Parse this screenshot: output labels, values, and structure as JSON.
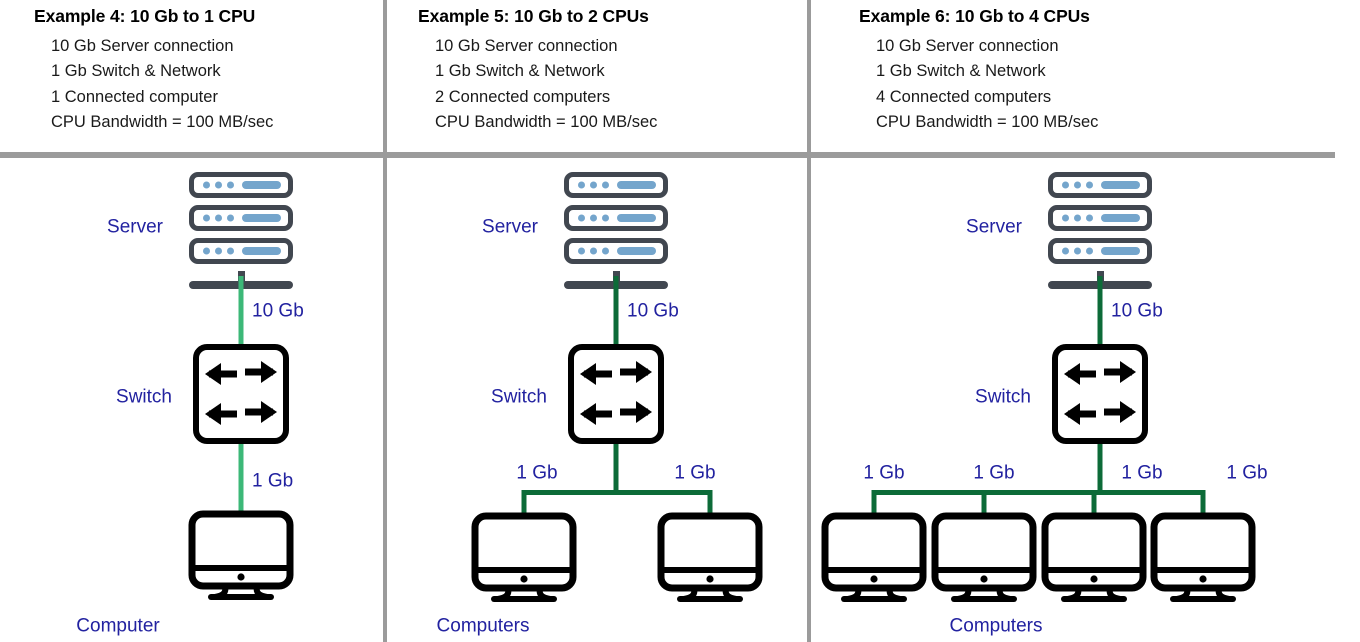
{
  "theme": {
    "label_color": "#2222a0",
    "link_color_dark": "#0c6b38",
    "link_color_light": "#3cb878",
    "server_color": "#414750",
    "server_accent": "#74a5cc",
    "divider_color": "#9b9b9b",
    "icon_color": "#000000",
    "background": "#ffffff"
  },
  "panels": [
    {
      "id": "example-4",
      "title": "Example 4: 10 Gb to 1 CPU",
      "specs": [
        "10 Gb Server connection",
        "1 Gb Switch & Network",
        "1 Connected computer",
        "CPU Bandwidth = 100 MB/sec"
      ],
      "server_label": "Server",
      "switch_label": "Switch",
      "computer_label": "Computer",
      "uplink_label": "10 Gb",
      "downlink_labels": [
        "1 Gb"
      ],
      "computer_count": 1
    },
    {
      "id": "example-5",
      "title": "Example 5: 10 Gb to 2 CPUs",
      "specs": [
        "10 Gb Server connection",
        "1 Gb Switch & Network",
        "2 Connected computers",
        "CPU Bandwidth = 100 MB/sec"
      ],
      "server_label": "Server",
      "switch_label": "Switch",
      "computer_label": "Computers",
      "uplink_label": "10 Gb",
      "downlink_labels": [
        "1 Gb",
        "1 Gb"
      ],
      "computer_count": 2
    },
    {
      "id": "example-6",
      "title": "Example 6: 10 Gb to 4 CPUs",
      "specs": [
        "10 Gb Server connection",
        "1 Gb Switch & Network",
        "4 Connected computers",
        "CPU Bandwidth = 100 MB/sec"
      ],
      "server_label": "Server",
      "switch_label": "Switch",
      "computer_label": "Computers",
      "uplink_label": "10 Gb",
      "downlink_labels": [
        "1 Gb",
        "1 Gb",
        "1 Gb",
        "1 Gb"
      ],
      "computer_count": 4
    }
  ],
  "icons": {
    "server": "server-rack-icon",
    "switch": "network-switch-icon",
    "computer": "desktop-monitor-icon"
  }
}
